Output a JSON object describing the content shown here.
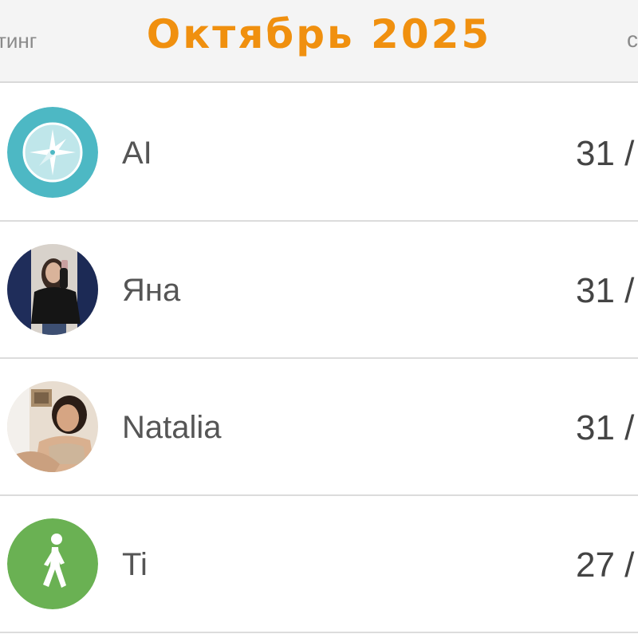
{
  "header": {
    "left_tab": "тинг",
    "title": "Октябрь 2025",
    "title_color": "#f0900f",
    "right_tab": "с"
  },
  "rows": [
    {
      "name": "AI",
      "score": "31 /",
      "avatar": "compass-icon",
      "avatar_color": "#4db8c4"
    },
    {
      "name": "Яна",
      "score": "31 /",
      "avatar": "photo"
    },
    {
      "name": "Natalia",
      "score": "31 /",
      "avatar": "photo"
    },
    {
      "name": "Ti",
      "score": "27 /",
      "avatar": "walking-person-icon",
      "avatar_color": "#6ab153"
    }
  ]
}
